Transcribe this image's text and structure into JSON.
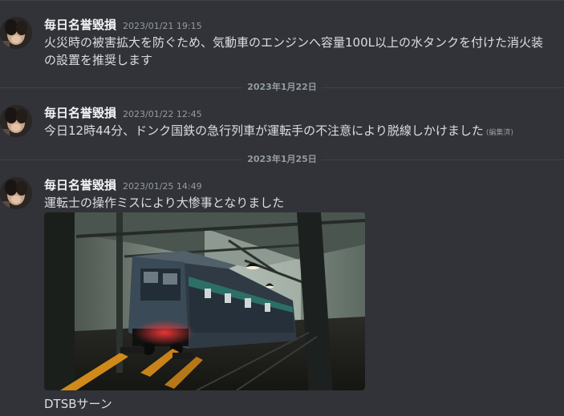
{
  "dividers": [
    {
      "label": ""
    },
    {
      "label": "2023年1月22日"
    },
    {
      "label": "2023年1月25日"
    }
  ],
  "messages": [
    {
      "username": "毎日名誉毀損",
      "timestamp": "2023/01/21 19:15",
      "text_lines": [
        "火災時の被害拡大を防ぐため、気動車のエンジンへ容量100L以上の水タンクを付けた消火装",
        "の設置を推奨します"
      ]
    },
    {
      "username": "毎日名誉毀損",
      "timestamp": "2023/01/22 12:45",
      "text": "今日12時44分、ドンク国鉄の急行列車が運転手の不注意により脱線しかけました",
      "edited_label": "(編集済)"
    },
    {
      "username": "毎日名誉毀損",
      "timestamp": "2023/01/25 14:49",
      "text": "運転士の操作ミスにより大惨事となりました",
      "caption": "DTSBサーン"
    }
  ]
}
